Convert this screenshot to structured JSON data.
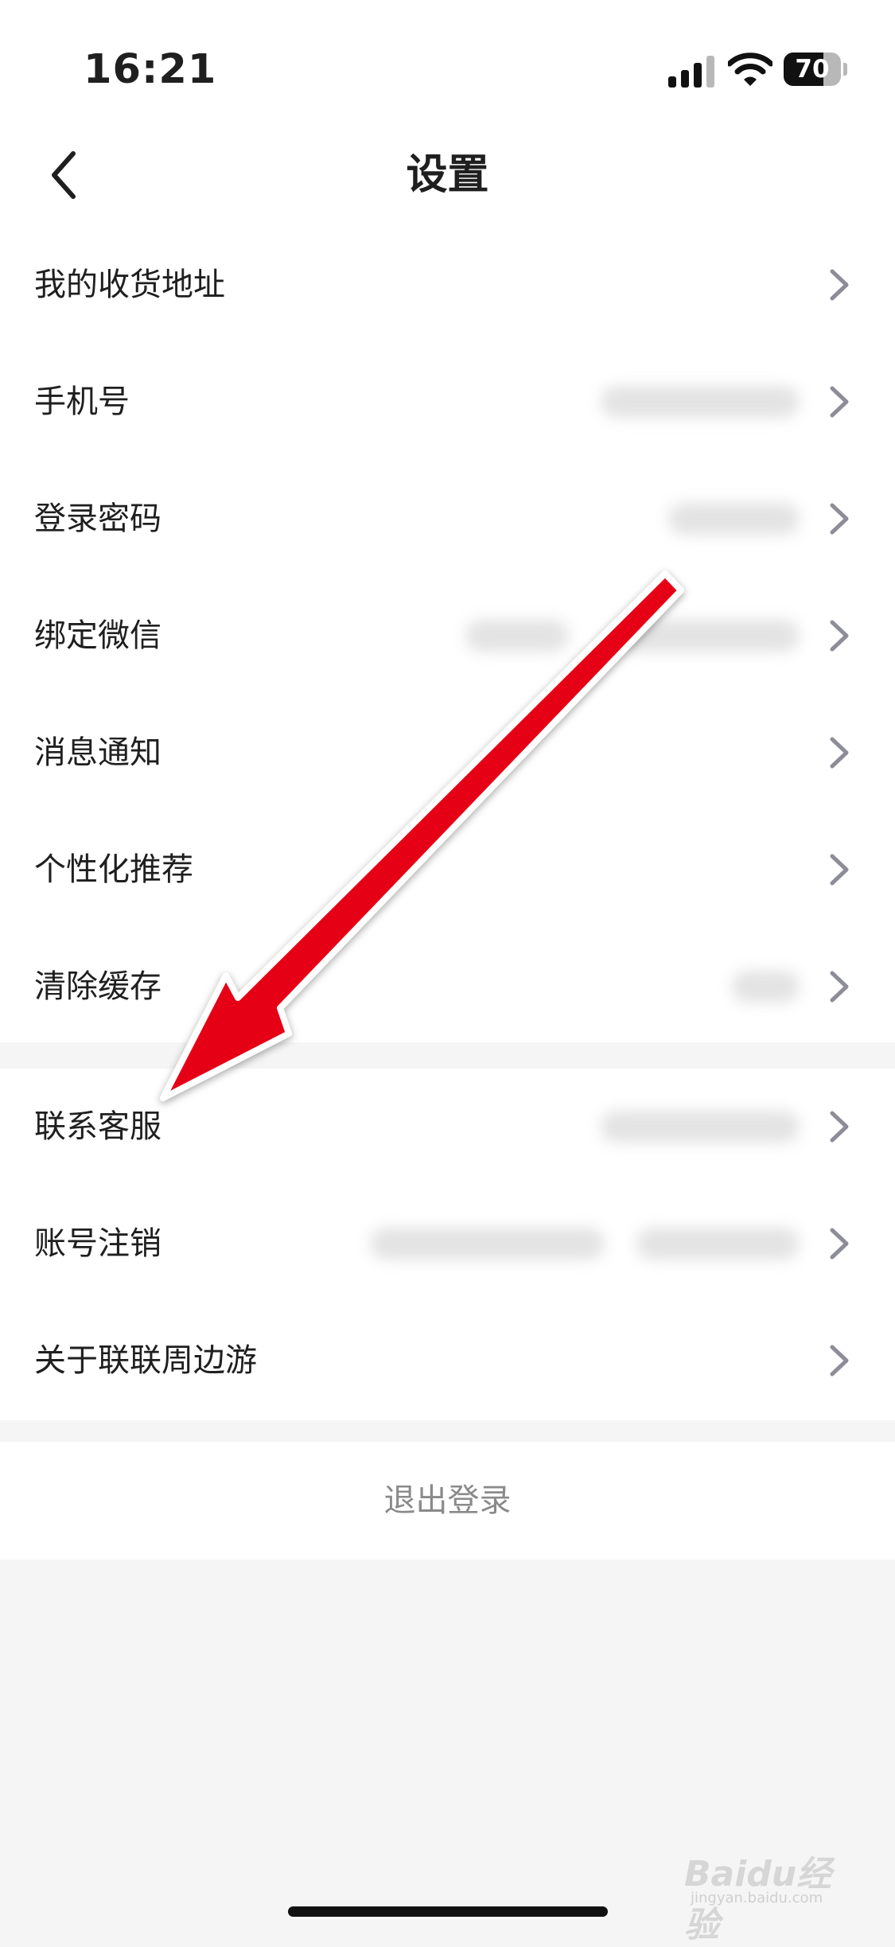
{
  "status_bar": {
    "time": "16:21",
    "battery_level": 70,
    "battery_text": "70"
  },
  "header": {
    "title": "设置"
  },
  "settings_group_1": [
    {
      "label": "我的收货地址"
    },
    {
      "label": "手机号"
    },
    {
      "label": "登录密码"
    },
    {
      "label": "绑定微信"
    },
    {
      "label": "消息通知"
    },
    {
      "label": "个性化推荐"
    },
    {
      "label": "清除缓存"
    }
  ],
  "settings_group_2": [
    {
      "label": "联系客服"
    },
    {
      "label": "账号注销"
    },
    {
      "label": "关于联联周边游"
    }
  ],
  "logout": {
    "label": "退出登录"
  },
  "watermark": {
    "logo": "Baidu经验",
    "sub": "jingyan.baidu.com"
  },
  "colors": {
    "annotation_arrow": "#e60012",
    "background": "#f5f5f5",
    "card": "#ffffff"
  }
}
